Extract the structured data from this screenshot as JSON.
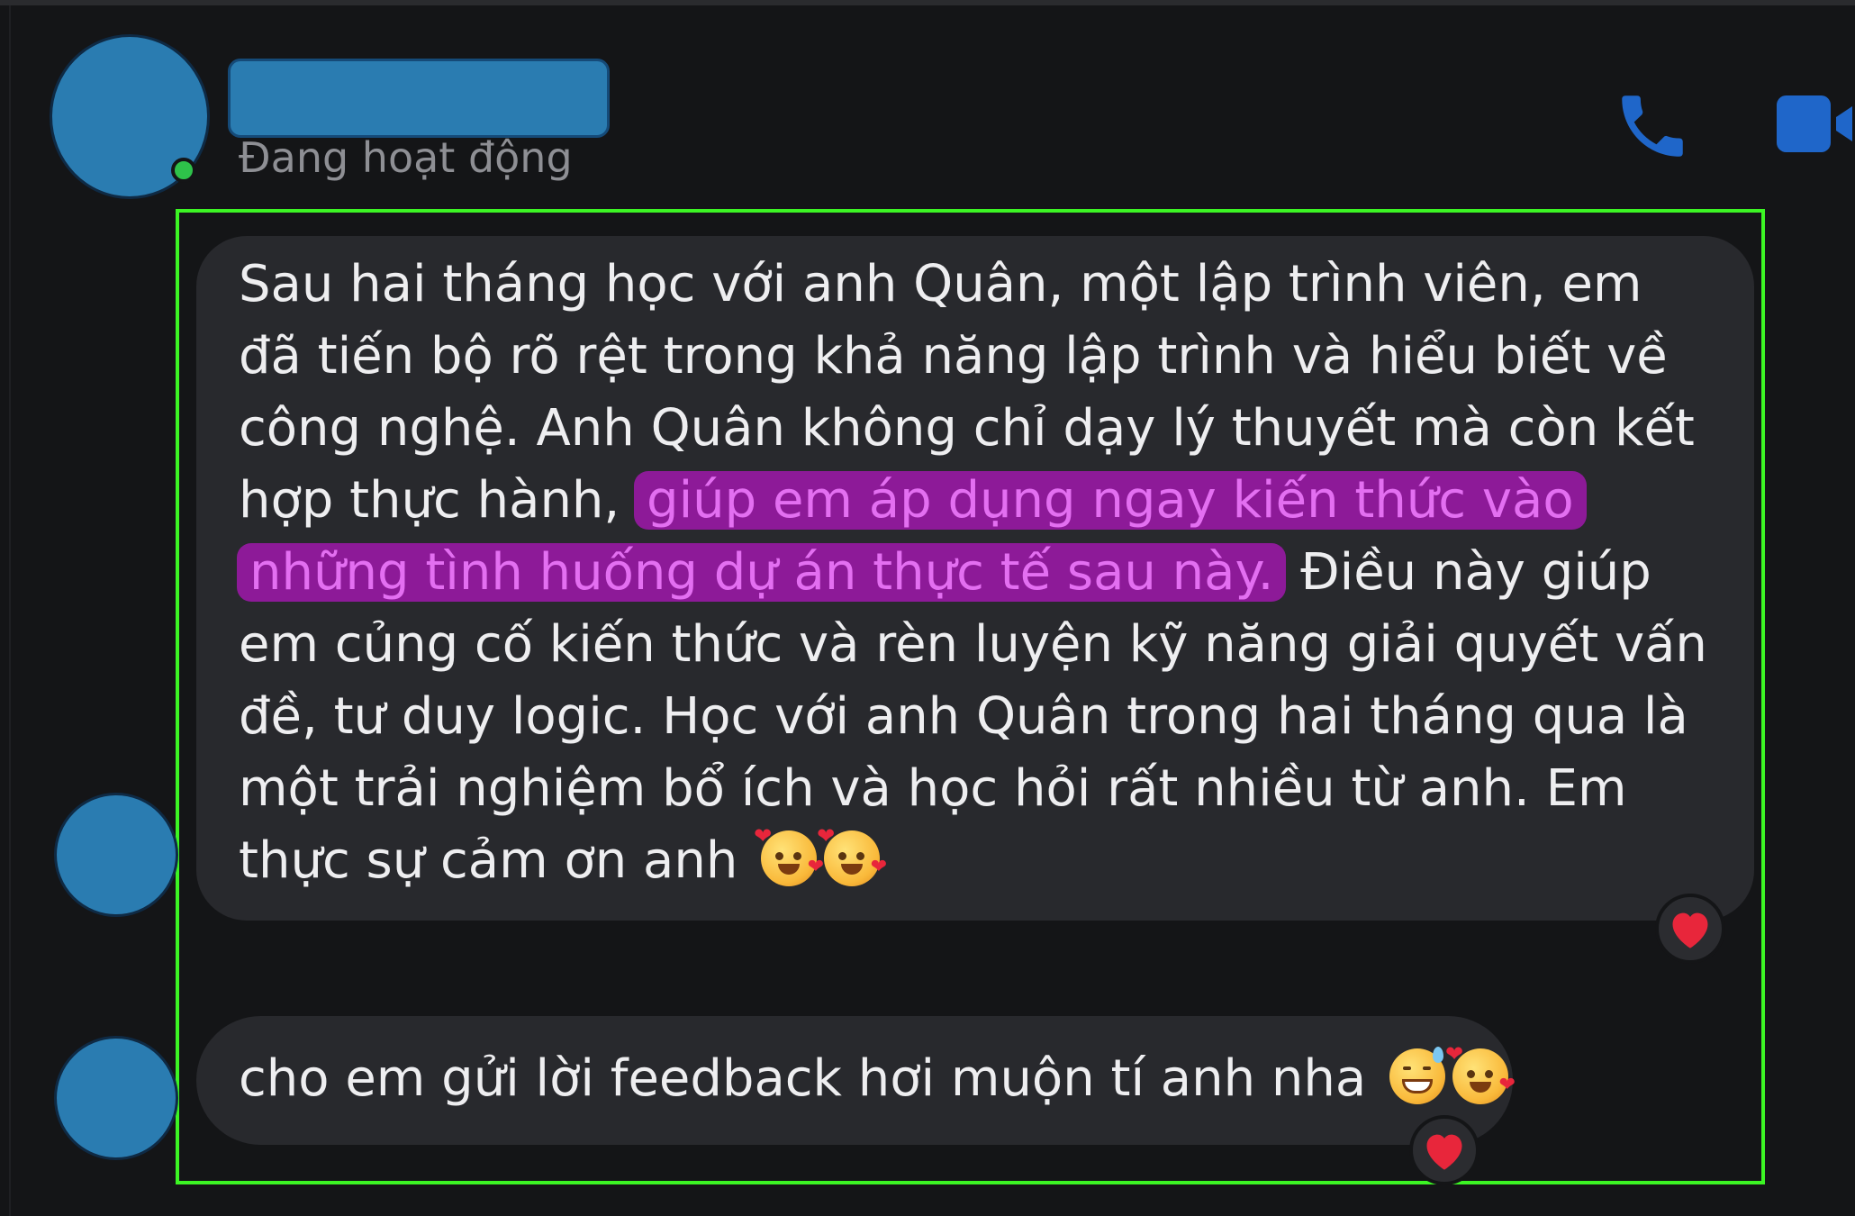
{
  "header": {
    "status_text": "Đang hoạt động",
    "icons": [
      "phone-icon",
      "video-camera-icon"
    ]
  },
  "messages": [
    {
      "text_before": "Sau hai tháng học với anh Quân, một lập trình viên, em đã tiến bộ rõ rệt trong khả năng lập trình và hiểu biết về công nghệ. Anh Quân không chỉ dạy lý thuyết mà còn kết hợp thực hành, ",
      "highlight": "giúp em áp dụng ngay kiến thức vào những tình huống dự án thực tế sau này.",
      "text_after": " Điều này giúp em củng cố kiến thức và rèn luyện kỹ năng giải quyết vấn đề, tư duy logic. Học với anh Quân trong hai tháng qua là một trải nghiệm bổ ích và học hỏi rất nhiều từ anh. Em thực sự cảm ơn anh ",
      "emojis": [
        "smiling-face-with-hearts",
        "smiling-face-with-hearts"
      ],
      "reaction": "heart"
    },
    {
      "text": "cho em gửi lời feedback hơi muộn tí anh nha ",
      "emojis": [
        "grinning-face-with-sweat",
        "smiling-face-with-hearts"
      ],
      "reaction": "heart"
    }
  ],
  "colors": {
    "background": "#141517",
    "bubble": "#28292d",
    "highlight_bg": "#8d1a98",
    "highlight_text": "#e36ff1",
    "frame": "#3cf524",
    "accent_blue": "#2a7cb1",
    "icon_blue": "#1f66c9",
    "online_green": "#2ec24a",
    "reaction_heart": "#e8263b"
  }
}
